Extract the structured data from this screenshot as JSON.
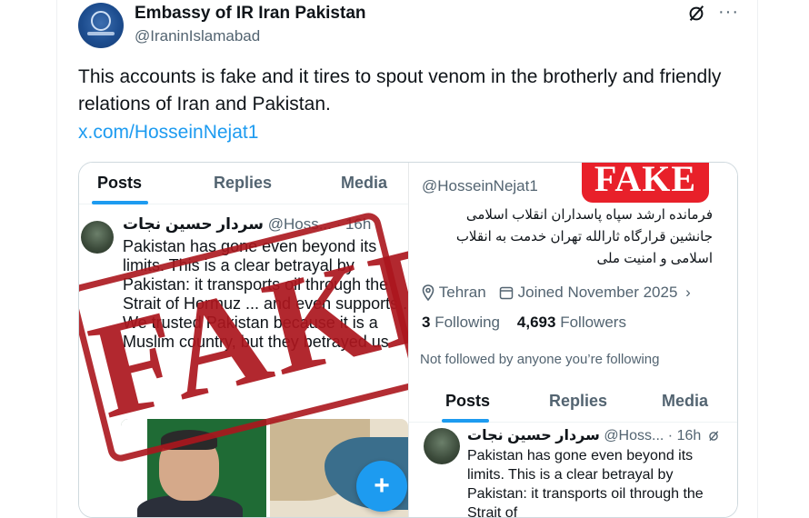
{
  "tweet": {
    "display_name": "Embassy of IR Iran Pakistan",
    "handle": "@IraninIslamabad",
    "text": "This accounts is fake and it tires to spout venom in the brotherly and friendly relations of Iran and Pakistan.",
    "link": "x.com/HosseinNejat1",
    "icons": {
      "grok": "grok-icon",
      "more": "more-icon"
    }
  },
  "embedded": {
    "left": {
      "tabs": [
        "Posts",
        "Replies",
        "Media"
      ],
      "post_name": "سردار حسین نجات",
      "post_handle_meta": "@Hoss... · 16h",
      "post_text": "Pakistan has gone even beyond its limits. This is a clear betrayal by Pakistan: it transports oil through the Strait of Hormuz ... and even supports ... We trusted Pakistan because it is a Muslim country, but they betrayed us",
      "stamp": "FAKE",
      "fab_symbol": "+"
    },
    "right": {
      "badge": "FAKE",
      "handle": "@HosseinNejat1",
      "bio": "فرمانده ارشد سپاه پاسداران انقلاب اسلامی جانشین قرارگاه ثارالله تهران خدمت به انقلاب اسلامی و امنیت ملی",
      "location": "Tehran",
      "joined": "Joined November 2025",
      "following_count": "3",
      "following_label": "Following",
      "followers_count": "4,693",
      "followers_label": "Followers",
      "not_followed": "Not followed by anyone you’re following",
      "tabs": [
        "Posts",
        "Replies",
        "Media"
      ],
      "post_name": "سردار حسین نجات",
      "post_handle": "@Hoss...",
      "post_time": "· 16h",
      "post_text": "Pakistan has gone even beyond its limits. This is a clear betrayal by Pakistan: it transports oil through the Strait of"
    }
  },
  "colors": {
    "accent": "#1d9bf0",
    "fake_red": "#e8202a",
    "stamp_red": "#ab161d"
  }
}
